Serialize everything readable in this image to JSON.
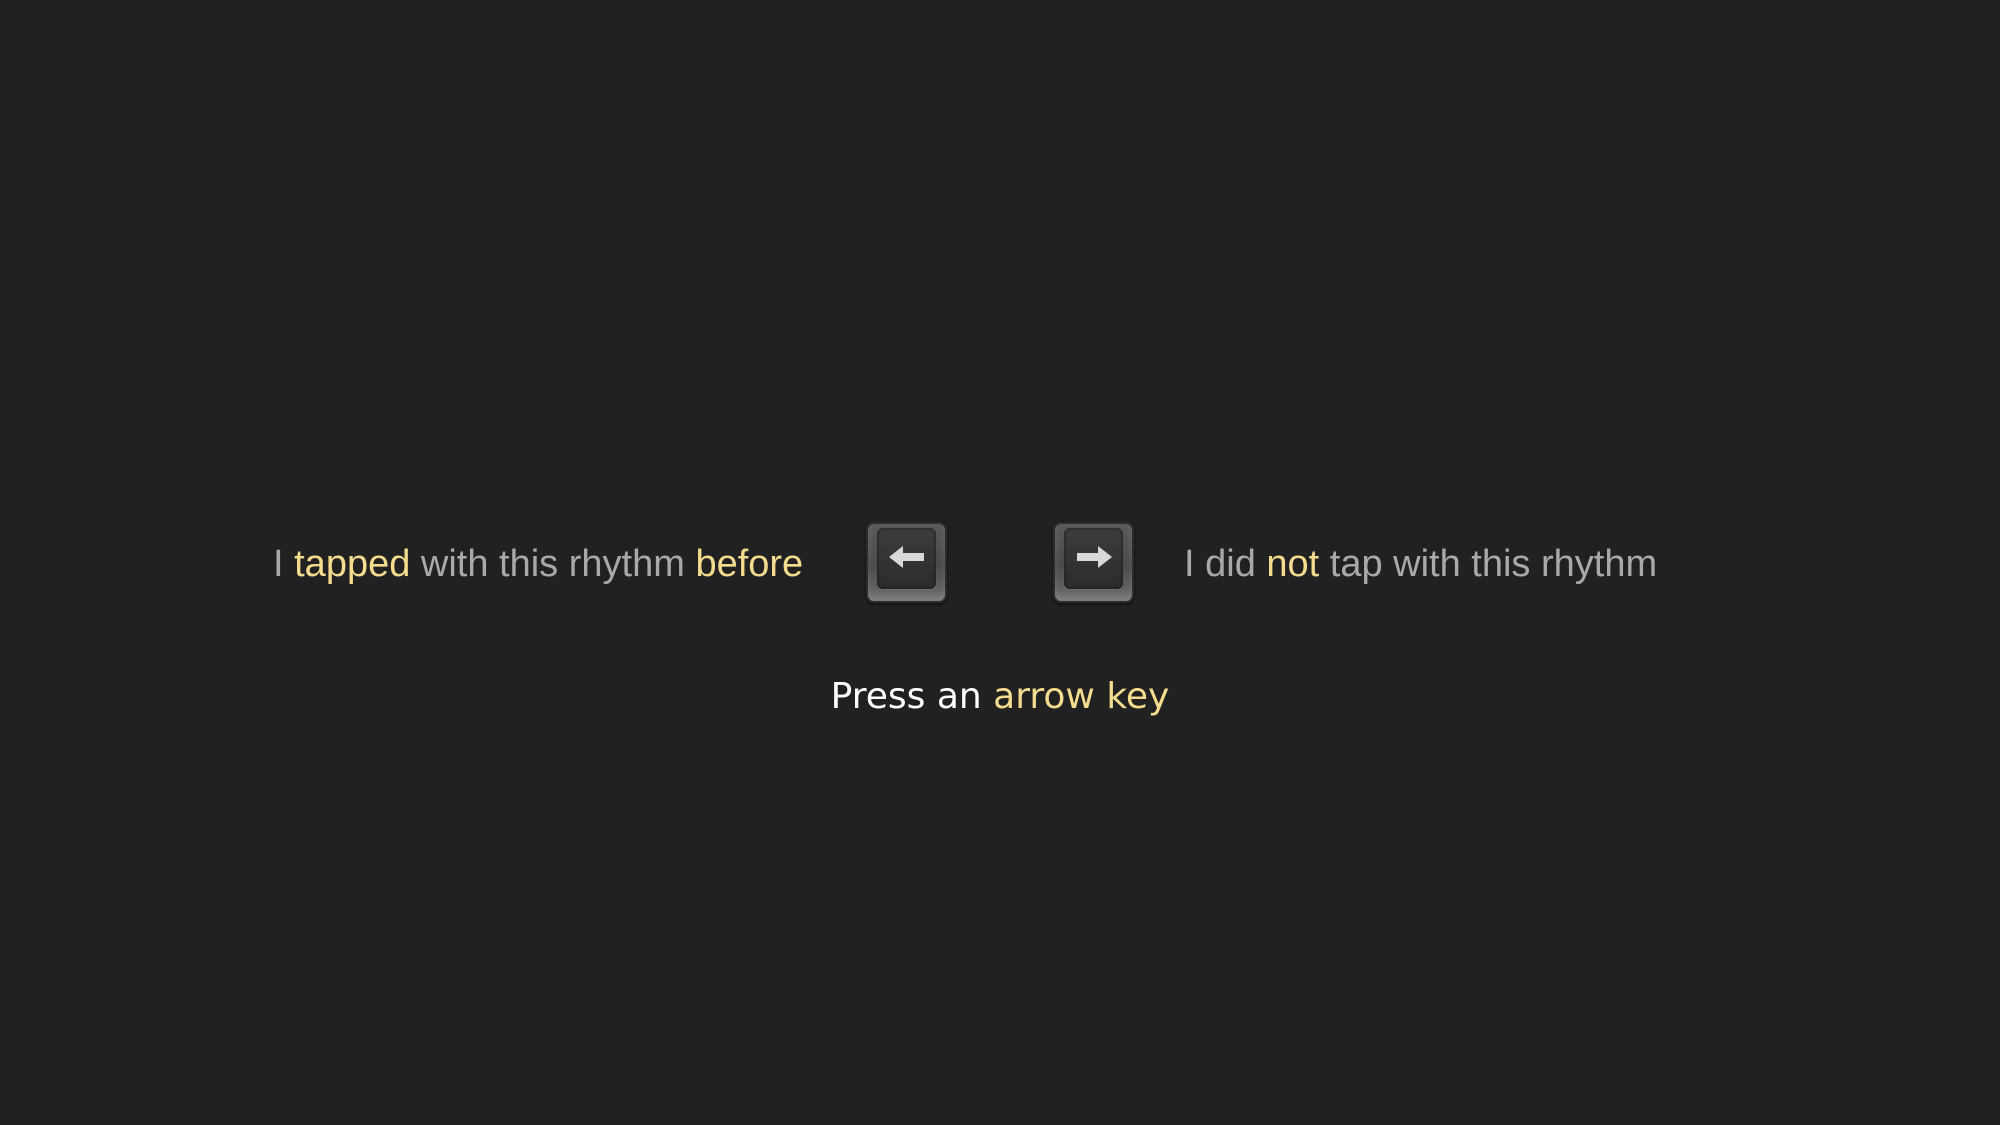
{
  "colors": {
    "background": "#212121",
    "text": "#a9a9a9",
    "highlight": "#f3dc8e",
    "prompt": "#ffffff"
  },
  "left_choice": {
    "part1": "I ",
    "part2": "tapped",
    "part3": " with this rhythm ",
    "part4": "before",
    "key_icon": "left-arrow-icon"
  },
  "right_choice": {
    "part1": "I did ",
    "part2": "not",
    "part3": " tap with this rhythm",
    "key_icon": "right-arrow-icon"
  },
  "prompt": {
    "part1": "Press an ",
    "part2": "arrow key"
  }
}
